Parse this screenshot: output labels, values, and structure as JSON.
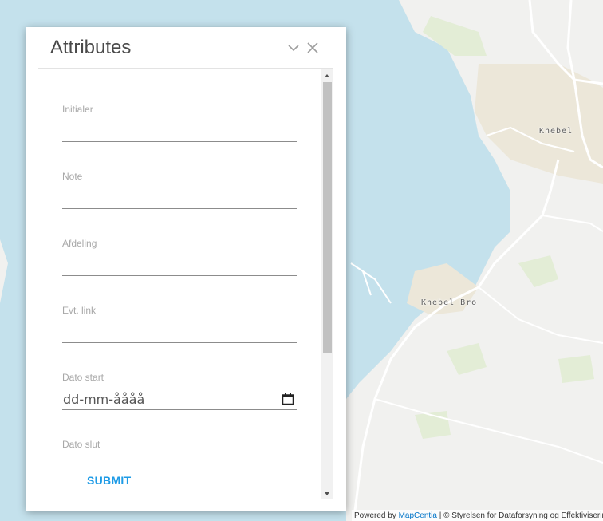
{
  "map": {
    "labels": {
      "town": "Knebel",
      "harbor": "Knebel Bro"
    },
    "colors": {
      "water": "#c4e1ec",
      "land": "#f1f1ef",
      "urban": "#ece7d9",
      "green": "#e3edd6",
      "roads": "#ffffff"
    },
    "attribution": {
      "prefix": "Powered by ",
      "link": "MapCentia",
      "suffix": " | © Styrelsen for Dataforsyning og Effektivisering"
    }
  },
  "panel": {
    "title": "Attributes",
    "fields": [
      {
        "label": "Initialer",
        "value": ""
      },
      {
        "label": "Note",
        "value": ""
      },
      {
        "label": "Afdeling",
        "value": ""
      },
      {
        "label": "Evt. link",
        "value": ""
      },
      {
        "label": "Dato start",
        "value": "dd-mm-åååå"
      },
      {
        "label": "Dato slut",
        "value": ""
      }
    ],
    "submit_label": "SUBMIT",
    "accent_color": "#1e9be6"
  }
}
